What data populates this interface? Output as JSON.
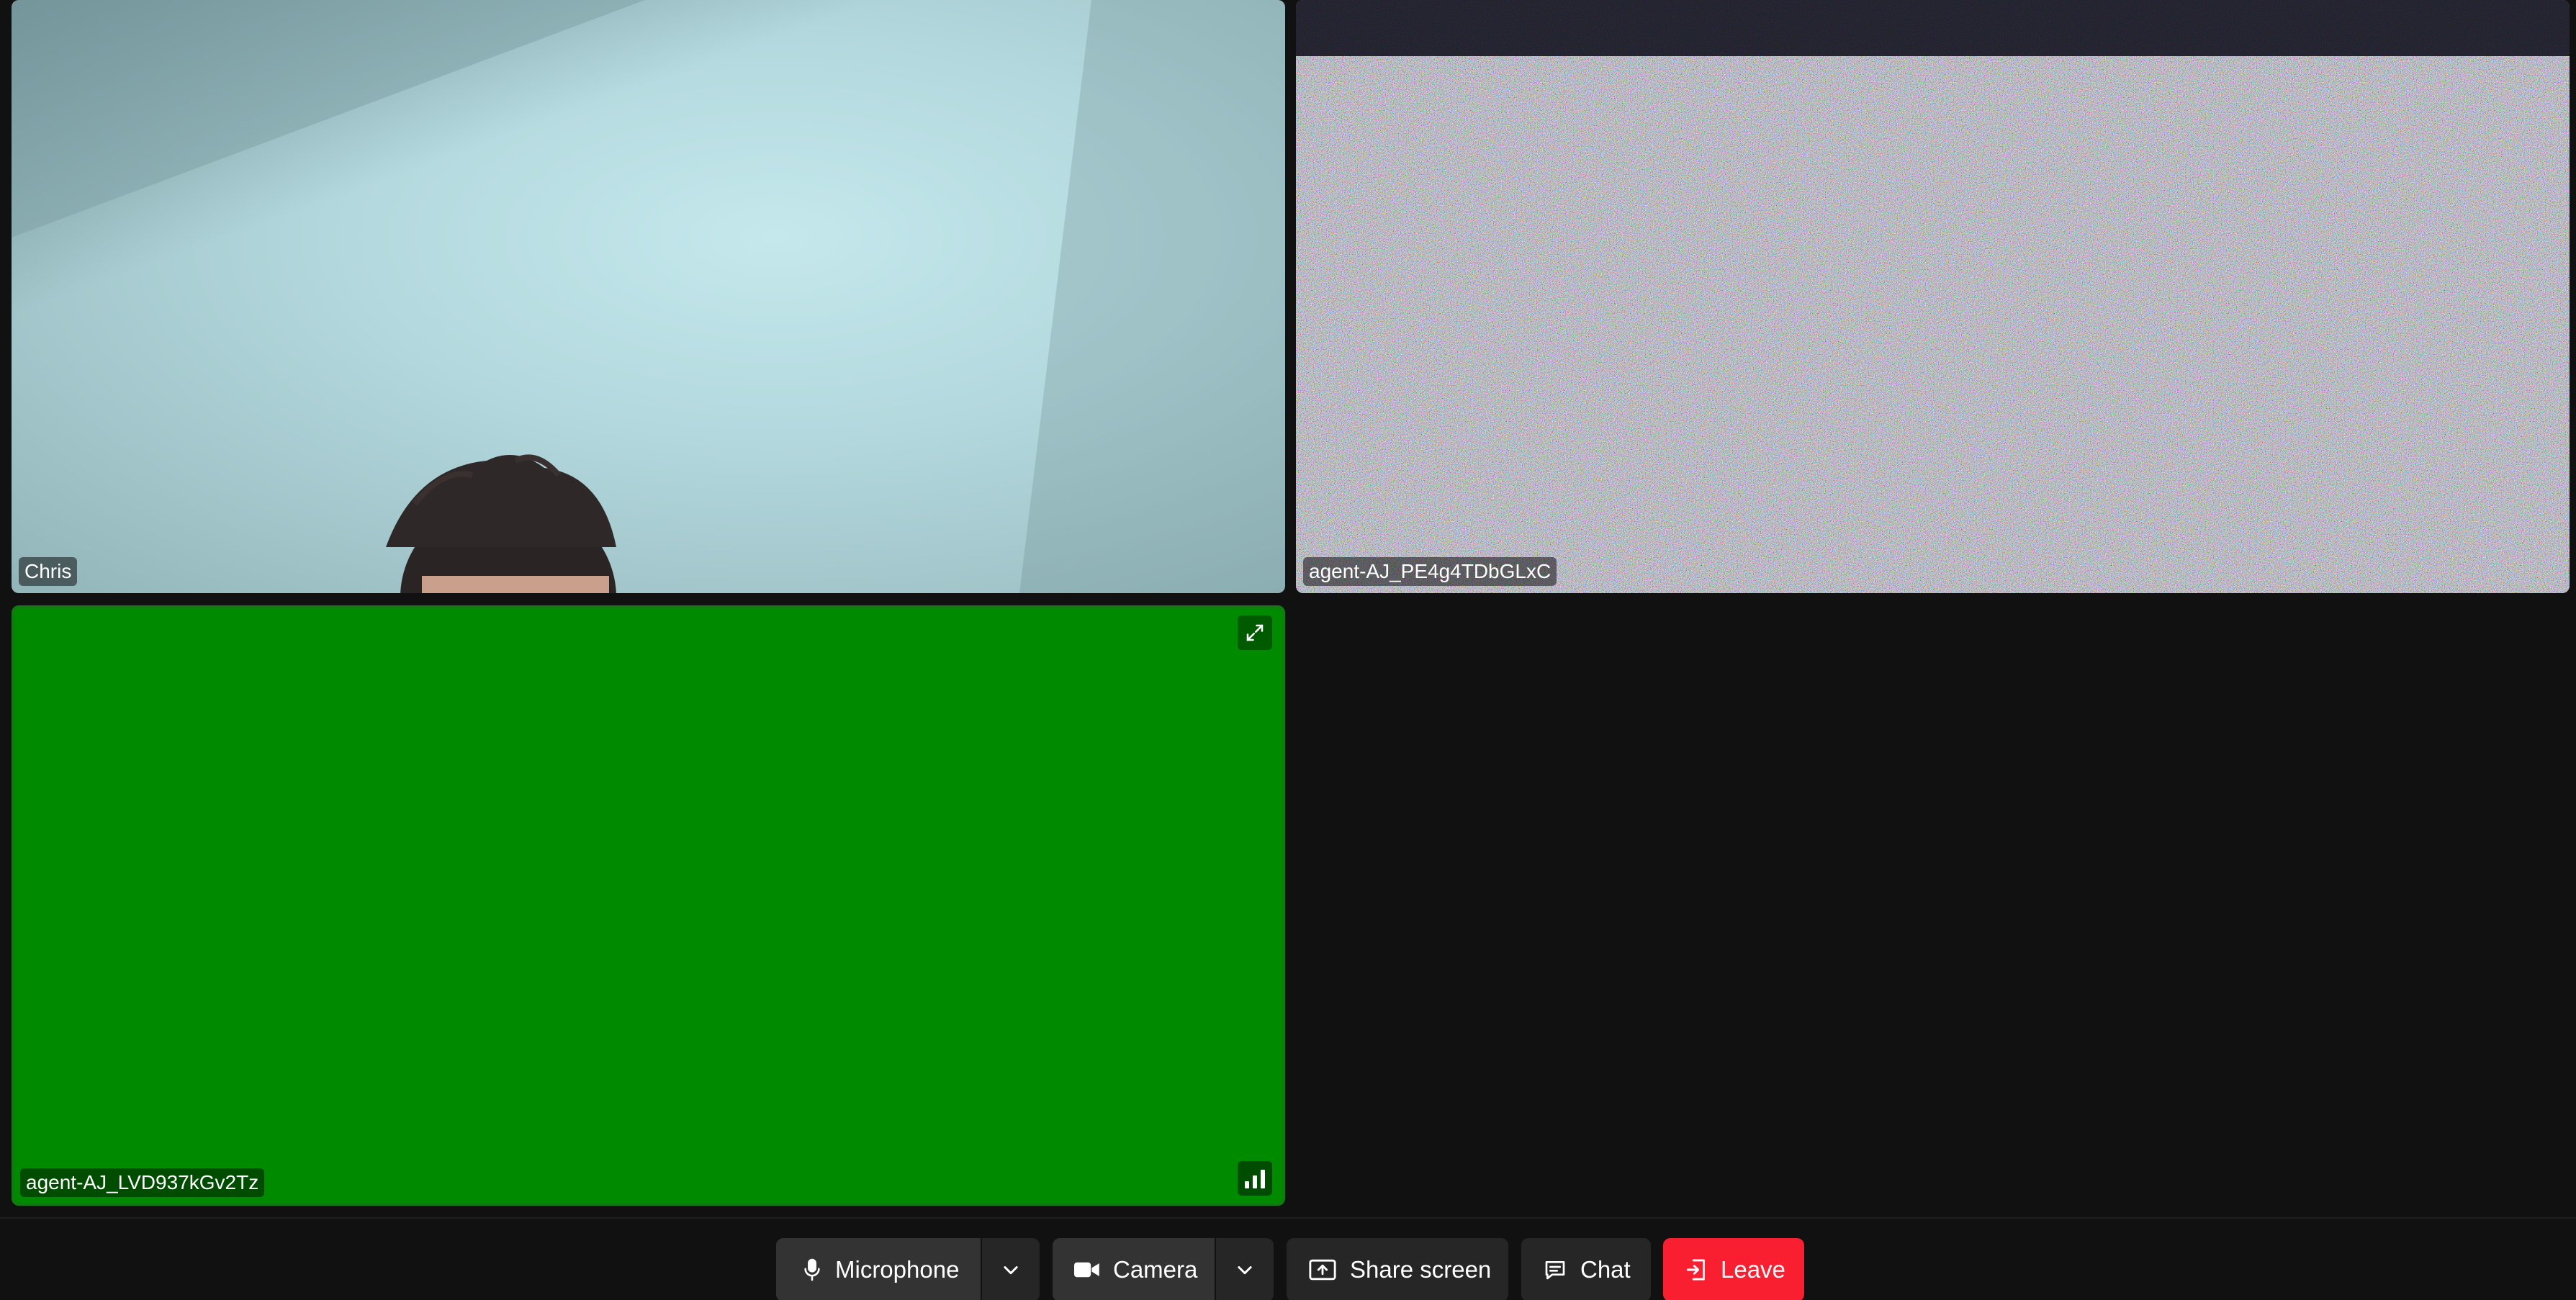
{
  "participants": [
    {
      "name": "Chris",
      "video": "camera"
    },
    {
      "name": "agent-AJ_PE4g4TDbGLxC",
      "video": "noise"
    },
    {
      "name": "agent-AJ_LVD937kGv2Tz",
      "video": "solid-green",
      "tile_color": "#008a00",
      "connection_quality_bars": 3
    }
  ],
  "controls": {
    "microphone_label": "Microphone",
    "camera_label": "Camera",
    "share_screen_label": "Share screen",
    "chat_label": "Chat",
    "leave_label": "Leave"
  },
  "icons": {
    "microphone": "microphone-icon",
    "camera": "video-camera-icon",
    "share": "share-screen-icon",
    "chat": "chat-bubble-icon",
    "leave": "leave-door-icon",
    "expand": "expand-icon",
    "signal": "signal-strength-icon",
    "menu": "chevron-down-icon"
  },
  "colors": {
    "background": "#111111",
    "button": "#262626",
    "button_active": "#333333",
    "leave": "#f91f31",
    "green_tile": "#008a00"
  }
}
